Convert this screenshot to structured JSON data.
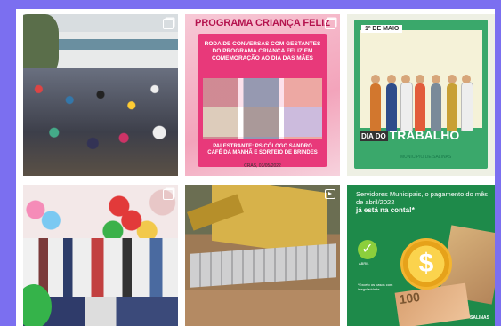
{
  "posts": [
    {
      "id": "crowd-photo",
      "kind": "carousel"
    },
    {
      "id": "crianca-feliz",
      "kind": "carousel",
      "headline": "PROGRAMA CRIANÇA FELIZ",
      "body": "RODA DE CONVERSAS COM GESTANTES DO PROGRAMA CRIANÇA FELIZ EM COMEMORAÇÃO AO DIA DAS MÃES",
      "speaker": "PALESTRANTE: PSICÓLOGO SANDRO",
      "extra": "CAFÉ DA MANHÃ E SORTEIO DE BRINDES",
      "date": "CRAS, 03/05/2022"
    },
    {
      "id": "dia-do-trabalho",
      "kind": "single",
      "date_label": "1º DE MAIO",
      "title_prefix": "DIA DO",
      "title": "TRABALHO",
      "logo_text": "MUNICÍPIO DE SALINAS"
    },
    {
      "id": "balloons-photo",
      "kind": "carousel"
    },
    {
      "id": "machinery",
      "kind": "reel"
    },
    {
      "id": "servidores",
      "kind": "single",
      "headline": "Servidores Municipais, o pagamento do mês de abril/2022",
      "emphasis": "já está na conta!*",
      "check_label": "ABRIL",
      "coin_symbol": "$",
      "note_value": "100",
      "small_text": "*Exceto os casos com irregularidade",
      "logo_text": "SALINAS"
    }
  ],
  "colors": {
    "background": "#7b6ff0",
    "feed": "#ffffff",
    "pink": "#e8397a",
    "green": "#1e8a4a"
  }
}
